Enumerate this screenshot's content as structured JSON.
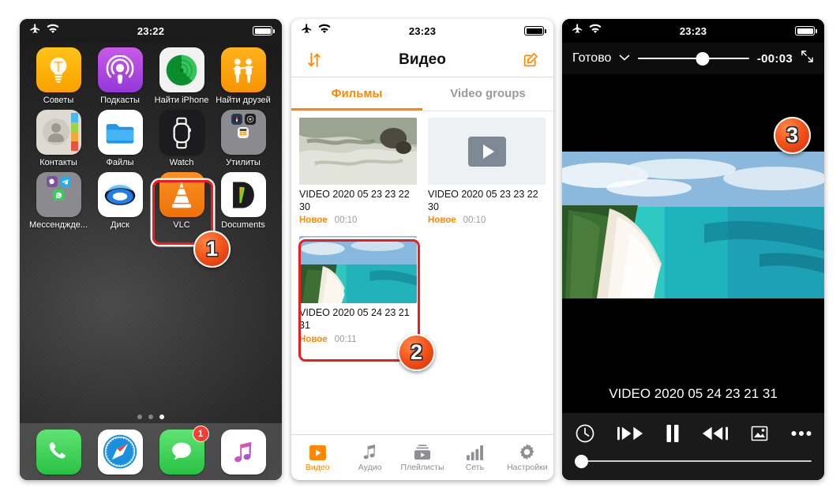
{
  "accent": {
    "orange": "#ff8800",
    "red": "#ee1c1c",
    "badge_red": "#fe3b30"
  },
  "panel_home": {
    "status": {
      "airplane_icon": "airplane-icon",
      "wifi_icon": "wifi-icon",
      "time": "23:22",
      "battery_icon": "battery-icon"
    },
    "apps": [
      {
        "label": "Советы",
        "icon": "tips-icon"
      },
      {
        "label": "Подкасты",
        "icon": "podcasts-icon"
      },
      {
        "label": "Найти iPhone",
        "icon": "find-iphone-icon"
      },
      {
        "label": "Найти друзей",
        "icon": "find-friends-icon"
      },
      {
        "label": "Контакты",
        "icon": "contacts-icon"
      },
      {
        "label": "Файлы",
        "icon": "files-icon"
      },
      {
        "label": "Watch",
        "icon": "watch-icon"
      },
      {
        "label": "Утилиты",
        "icon": "utilities-folder-icon"
      },
      {
        "label": "Мессенджде...",
        "icon": "messengers-folder-icon"
      },
      {
        "label": "Диск",
        "icon": "yandex-disk-icon"
      },
      {
        "label": "VLC",
        "icon": "vlc-icon"
      },
      {
        "label": "Documents",
        "icon": "documents-icon"
      }
    ],
    "page_dots": {
      "count": 3,
      "active_index": 2
    },
    "dock": [
      {
        "label": "Телефон",
        "icon": "phone-icon",
        "badge": ""
      },
      {
        "label": "Safari",
        "icon": "safari-icon",
        "badge": ""
      },
      {
        "label": "Сообщения",
        "icon": "messages-icon",
        "badge": "1"
      },
      {
        "label": "Музыка",
        "icon": "music-icon",
        "badge": ""
      }
    ]
  },
  "panel_library": {
    "status": {
      "time": "23:23"
    },
    "nav": {
      "sort_icon": "sort-arrows-icon",
      "title": "Видео",
      "edit_icon": "edit-compose-icon"
    },
    "tabs": [
      {
        "label": "Фильмы",
        "active": true
      },
      {
        "label": "Video groups",
        "active": false
      }
    ],
    "videos": [
      {
        "title": "VIDEO 2020 05 23 23 22 30",
        "badge": "Новое",
        "duration": "00:10",
        "thumb": "snow-field"
      },
      {
        "title": "VIDEO 2020 05 23 23 22 30",
        "badge": "Новое",
        "duration": "00:10",
        "thumb": "placeholder"
      },
      {
        "title": "VIDEO 2020 05 24 23 21 31",
        "badge": "Новое",
        "duration": "00:11",
        "thumb": "beach"
      }
    ],
    "tabbar": [
      {
        "label": "Видео",
        "icon": "video-icon",
        "active": true
      },
      {
        "label": "Аудио",
        "icon": "music-note-icon",
        "active": false
      },
      {
        "label": "Плейлисты",
        "icon": "playlists-icon",
        "active": false
      },
      {
        "label": "Сеть",
        "icon": "network-bars-icon",
        "active": false
      },
      {
        "label": "Настройки",
        "icon": "gear-icon",
        "active": false
      }
    ]
  },
  "panel_player": {
    "status": {
      "time": "23:23"
    },
    "top": {
      "done_label": "Готово",
      "chevron_icon": "chevron-down-icon",
      "volume_icon": "volume-slider",
      "remaining_time": "-00:03",
      "expand_icon": "expand-arrows-icon"
    },
    "video_title": "VIDEO 2020 05 24 23 21 31",
    "controls": [
      {
        "icon": "sleep-timer-clock-icon",
        "name": "sleep-timer-button"
      },
      {
        "icon": "previous-track-icon",
        "name": "previous-button"
      },
      {
        "icon": "pause-icon",
        "name": "pause-button"
      },
      {
        "icon": "next-track-icon",
        "name": "next-button"
      },
      {
        "icon": "aspect-ratio-icon",
        "name": "aspect-ratio-button"
      },
      {
        "icon": "more-dots-icon",
        "name": "more-options-button"
      }
    ],
    "seek_percent": 2
  },
  "callouts": [
    {
      "number": "1"
    },
    {
      "number": "2"
    },
    {
      "number": "3"
    }
  ]
}
